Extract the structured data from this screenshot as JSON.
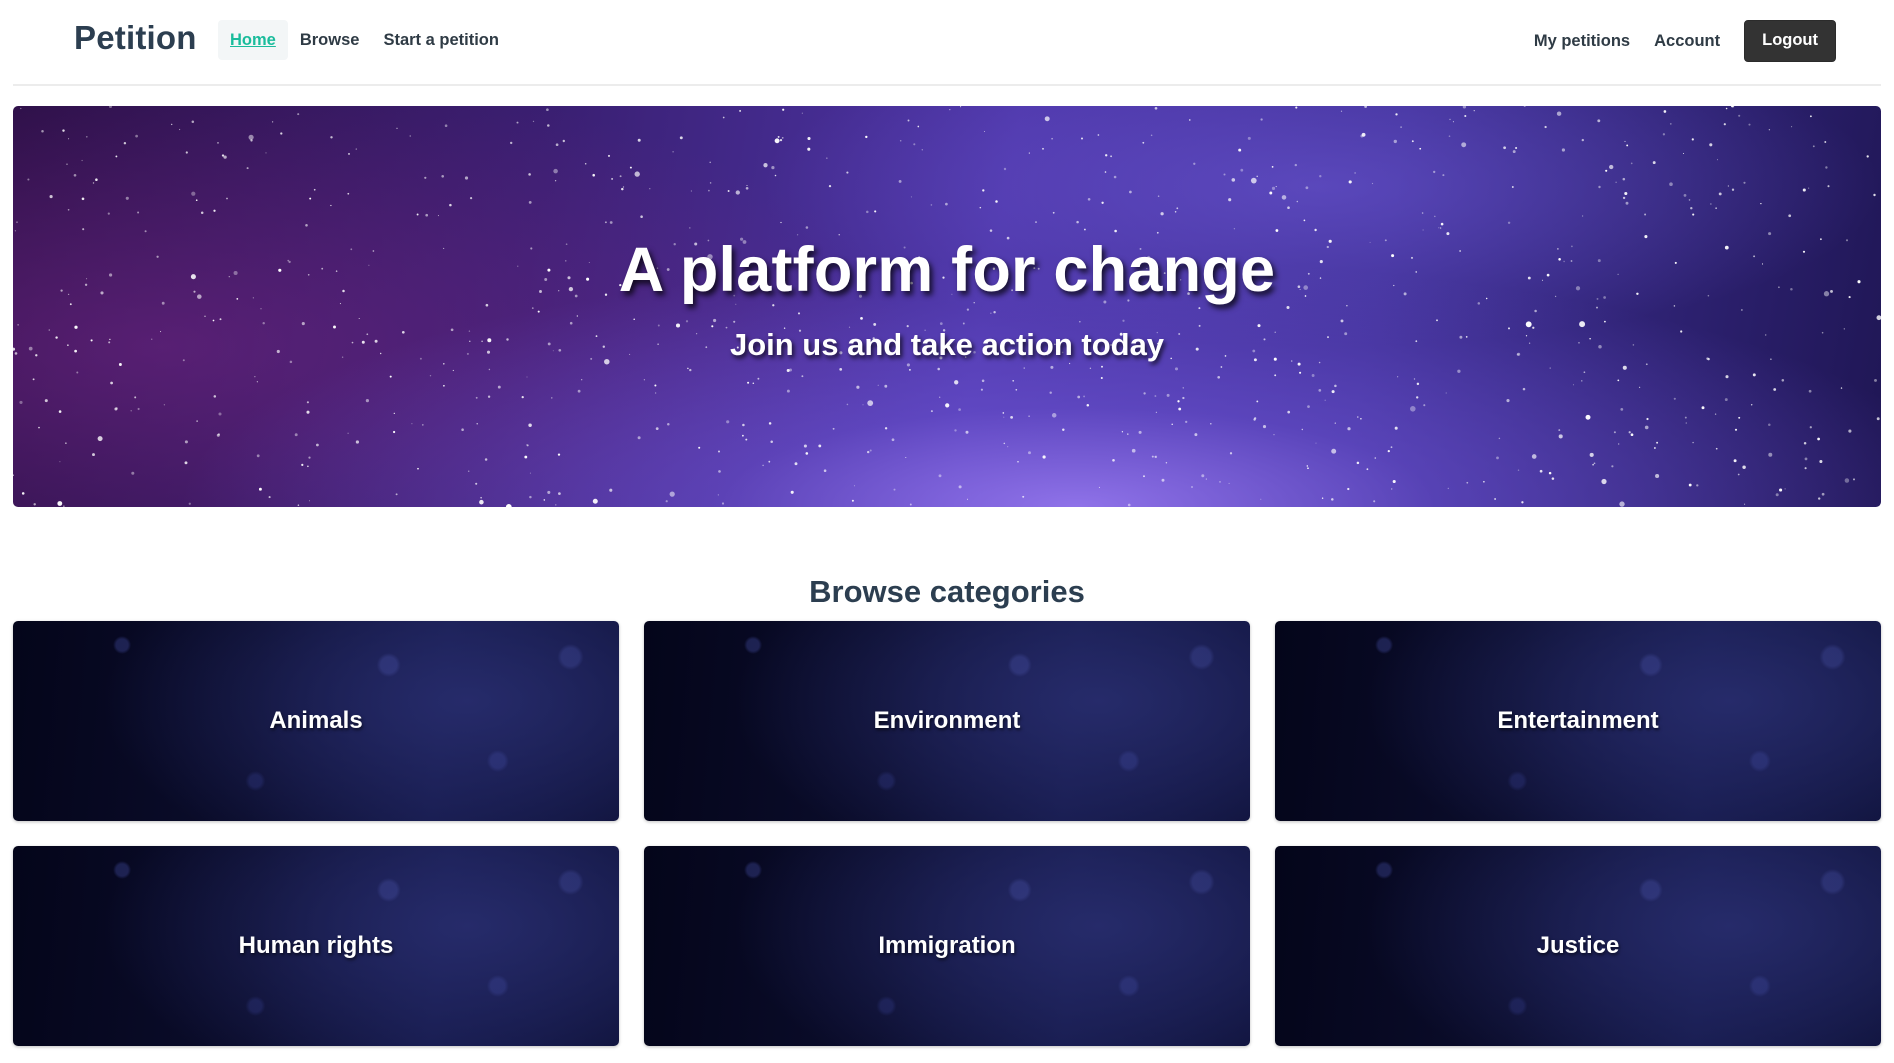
{
  "navbar": {
    "brand": "Petition",
    "left_links": [
      {
        "label": "Home",
        "active": true
      },
      {
        "label": "Browse",
        "active": false
      },
      {
        "label": "Start a petition",
        "active": false
      }
    ],
    "right_links": [
      {
        "label": "My petitions"
      },
      {
        "label": "Account"
      }
    ],
    "logout_label": "Logout"
  },
  "hero": {
    "title": "A platform for change",
    "subtitle": "Join us and take action today"
  },
  "categories": {
    "heading": "Browse categories",
    "items": [
      {
        "label": "Animals"
      },
      {
        "label": "Environment"
      },
      {
        "label": "Entertainment"
      },
      {
        "label": "Human rights"
      },
      {
        "label": "Immigration"
      },
      {
        "label": "Justice"
      }
    ]
  },
  "colors": {
    "brand_text": "#2c3e50",
    "active_link": "#1abc9c",
    "logout_bg": "#333333",
    "hero_purple": "#4d36a8",
    "card_navy": "#0b0d2c"
  }
}
